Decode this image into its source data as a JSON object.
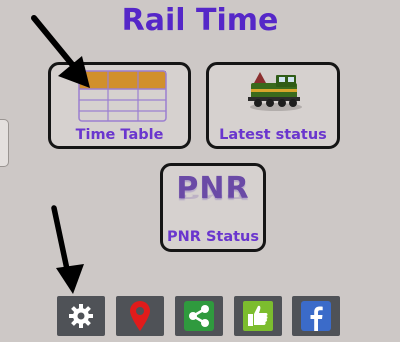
{
  "app": {
    "title": "Rail Time"
  },
  "tiles": {
    "time_table": {
      "label": "Time Table",
      "icon": "timetable-grid-icon"
    },
    "latest_status": {
      "label": "Latest status",
      "icon": "locomotive-icon"
    },
    "pnr_status": {
      "label": "PNR Status",
      "logo_text": "PNR"
    }
  },
  "bottom_bar": [
    {
      "icon": "gear-icon",
      "color": "#4f5257"
    },
    {
      "icon": "map-pin-icon",
      "color": "#e11b1b"
    },
    {
      "icon": "share-icon",
      "color": "#2f9a3e"
    },
    {
      "icon": "thumbs-up-icon",
      "color": "#7cbd2e"
    },
    {
      "icon": "facebook-icon",
      "color": "#3b6bc9"
    }
  ],
  "colors": {
    "background": "#cdc8c6",
    "accent": "#5527c8",
    "tile_label": "#6a36ce"
  }
}
